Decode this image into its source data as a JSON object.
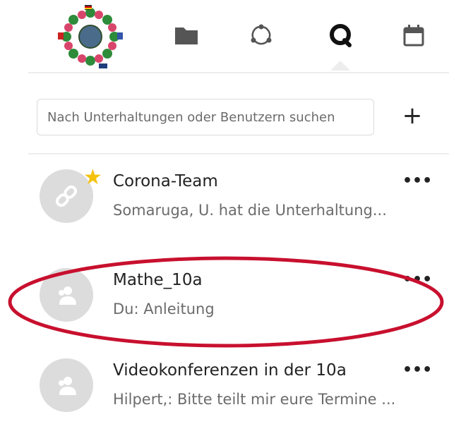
{
  "nav": {
    "items": [
      {
        "icon": "folder-icon",
        "label": "Files"
      },
      {
        "icon": "activity-icon",
        "label": "Activity"
      },
      {
        "icon": "talk-icon",
        "label": "Talk",
        "active": true
      },
      {
        "icon": "calendar-icon",
        "label": "Calendar"
      }
    ]
  },
  "search": {
    "placeholder": "Nach Unterhaltungen oder Benutzern suchen",
    "add_label": "+"
  },
  "conversations": [
    {
      "title": "Corona-Team",
      "subtitle": "Somaruga, U. hat die Unterhaltung...",
      "favorite": true,
      "avatar": "link-icon"
    },
    {
      "title": "Mathe_10a",
      "subtitle": "Du: Anleitung",
      "favorite": false,
      "avatar": "group-icon",
      "highlighted": true
    },
    {
      "title": "Videokonferenzen in der 10a",
      "subtitle": "Hilpert,: Bitte teilt mir eure Termine ...",
      "favorite": false,
      "avatar": "group-icon"
    }
  ],
  "more_label": "•••",
  "colors": {
    "highlight_ring": "#c8102e",
    "star": "#f4c20d",
    "avatar_bg": "#dcdcdc",
    "divider": "#ededed"
  }
}
